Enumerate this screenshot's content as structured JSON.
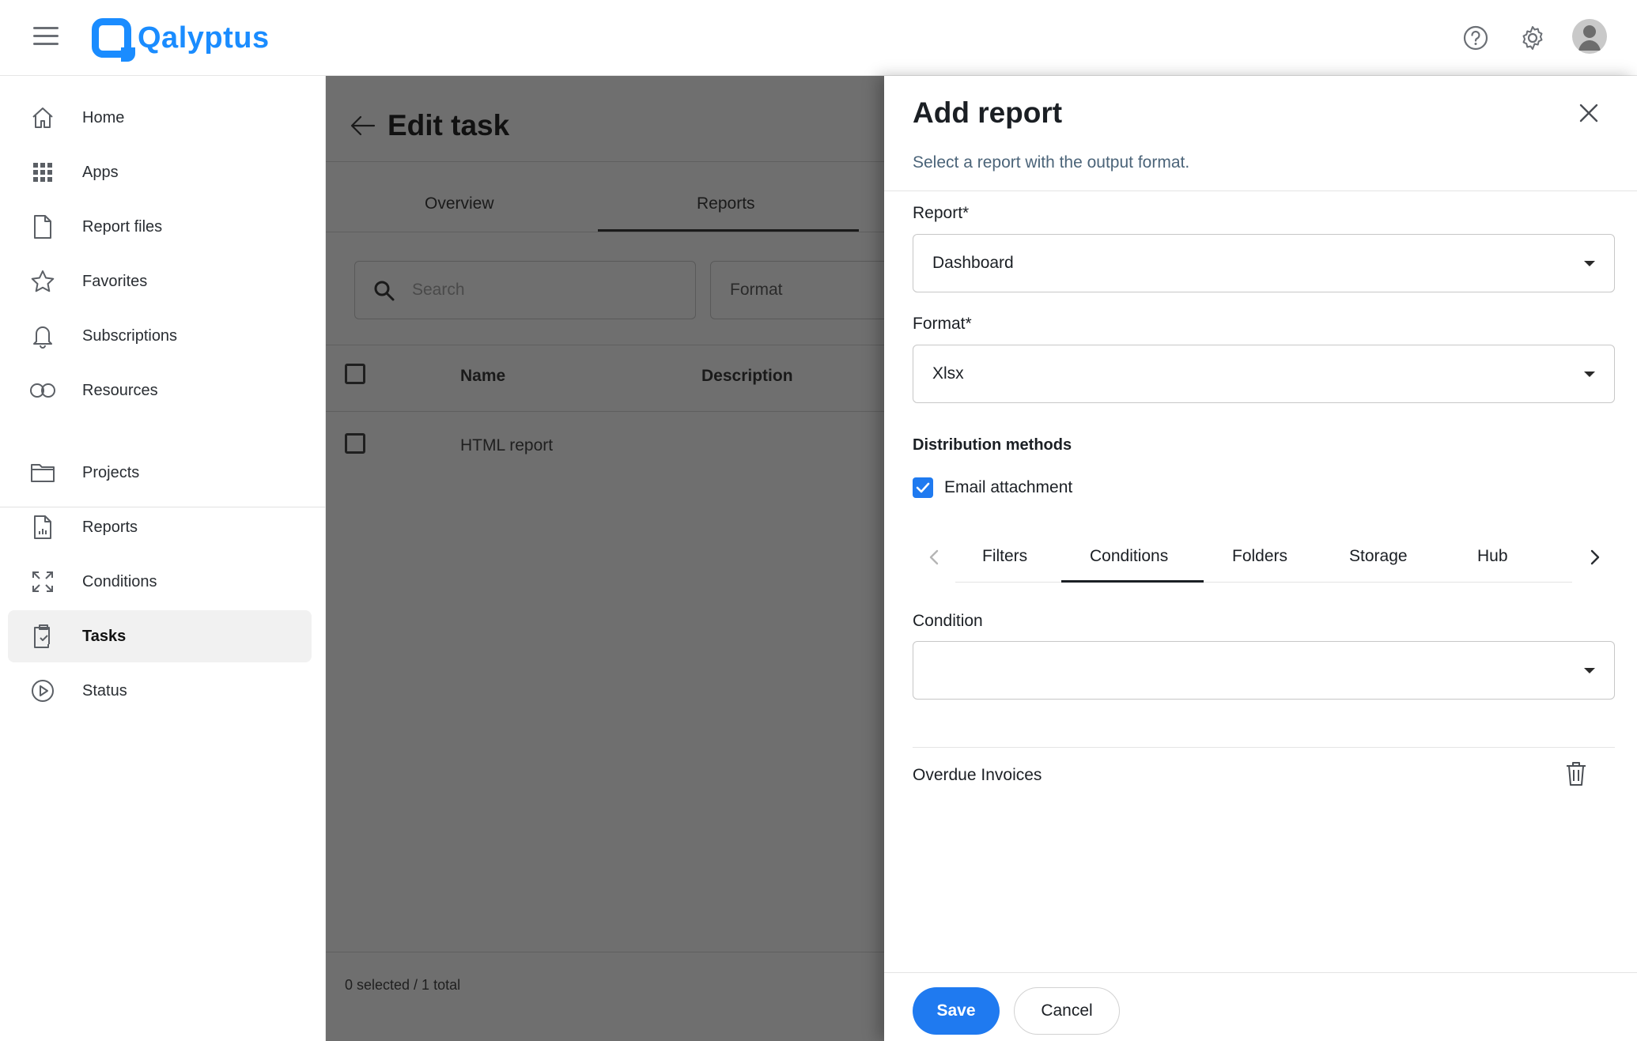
{
  "app": {
    "name": "Qalyptus"
  },
  "sidebar": {
    "items": [
      {
        "label": "Home",
        "icon": "home-icon"
      },
      {
        "label": "Apps",
        "icon": "grid-icon"
      },
      {
        "label": "Report files",
        "icon": "file-icon"
      },
      {
        "label": "Favorites",
        "icon": "star-icon"
      },
      {
        "label": "Subscriptions",
        "icon": "bell-icon"
      },
      {
        "label": "Resources",
        "icon": "link-icon"
      },
      {
        "label": "Projects",
        "icon": "folder-icon"
      },
      {
        "label": "Reports",
        "icon": "report-icon"
      },
      {
        "label": "Conditions",
        "icon": "expand-icon"
      },
      {
        "label": "Tasks",
        "icon": "clipboard-icon",
        "active": true
      },
      {
        "label": "Status",
        "icon": "play-circle-icon"
      }
    ]
  },
  "main": {
    "title": "Edit task",
    "tabs": [
      "Overview",
      "Reports"
    ],
    "active_tab": "Reports",
    "search_placeholder": "Search",
    "format_filter": "Format",
    "columns": [
      "Name",
      "Description"
    ],
    "rows": [
      {
        "name": "HTML report",
        "description": ""
      }
    ],
    "footer": "0 selected / 1 total"
  },
  "panel": {
    "title": "Add report",
    "subtitle": "Select a report with the output format.",
    "report_label": "Report*",
    "report_value": "Dashboard",
    "format_label": "Format*",
    "format_value": "Xlsx",
    "distribution_title": "Distribution methods",
    "email_label": "Email attachment",
    "email_checked": true,
    "tabs": [
      "Filters",
      "Conditions",
      "Folders",
      "Storage",
      "Hub"
    ],
    "active_tab": "Conditions",
    "condition_label": "Condition",
    "condition_value": "",
    "conditions": [
      "Overdue Invoices"
    ],
    "save_label": "Save",
    "cancel_label": "Cancel"
  },
  "colors": {
    "brand": "#1a8cff",
    "primary": "#1f7af0",
    "overlay": "#6f6f6f"
  }
}
